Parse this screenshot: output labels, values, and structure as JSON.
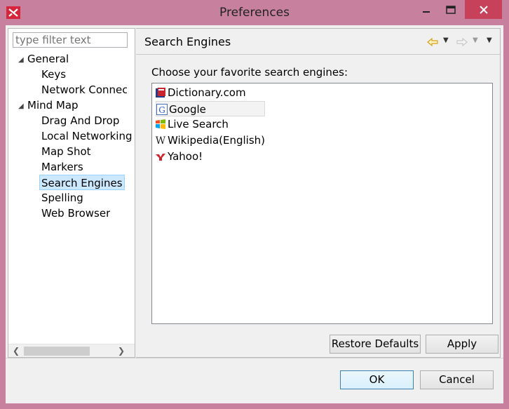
{
  "window": {
    "title": "Preferences",
    "controls": {
      "minimize": "minimize",
      "maximize": "maximize",
      "close": "close"
    }
  },
  "filter": {
    "placeholder": "type filter text"
  },
  "tree": {
    "items": [
      {
        "label": "General",
        "expanded": true,
        "level": 0
      },
      {
        "label": "Keys",
        "level": 1
      },
      {
        "label": "Network Connections",
        "level": 1
      },
      {
        "label": "Mind Map",
        "expanded": true,
        "level": 0
      },
      {
        "label": "Drag And Drop",
        "level": 1
      },
      {
        "label": "Local Networking",
        "level": 1
      },
      {
        "label": "Map Shot",
        "level": 1
      },
      {
        "label": "Markers",
        "level": 1
      },
      {
        "label": "Search Engines",
        "level": 1,
        "selected": true
      },
      {
        "label": "Spelling",
        "level": 1
      },
      {
        "label": "Web Browser",
        "level": 1
      }
    ]
  },
  "page": {
    "title": "Search Engines",
    "description": "Choose your favorite search engines:",
    "engines": [
      {
        "label": "Dictionary.com",
        "icon": "dictionary-icon"
      },
      {
        "label": "Google",
        "icon": "google-icon",
        "focused": true
      },
      {
        "label": "Live Search",
        "icon": "windows-icon"
      },
      {
        "label": "Wikipedia(English)",
        "icon": "wikipedia-icon"
      },
      {
        "label": "Yahoo!",
        "icon": "yahoo-icon"
      }
    ],
    "restore_defaults_label": "Restore Defaults",
    "apply_label": "Apply"
  },
  "dialog": {
    "ok_label": "OK",
    "cancel_label": "Cancel"
  },
  "colors": {
    "window_frame": "#c7819f",
    "close_button": "#c7415a",
    "selection": "#cce8ff",
    "nav_arrow": "#d9a21b"
  }
}
